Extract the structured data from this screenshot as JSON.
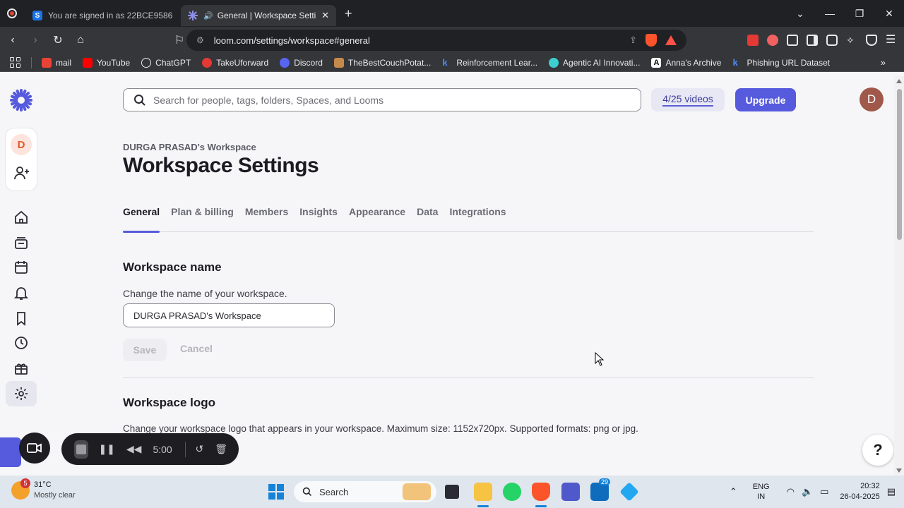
{
  "browser": {
    "tabs": [
      {
        "title": "You are signed in as 22BCE9586",
        "active": false,
        "favicon_color": "#1a73e8"
      },
      {
        "title": "General | Workspace Settings",
        "active": true,
        "favicon_color": "#565add"
      }
    ],
    "address": "loom.com/settings/workspace#general",
    "shields_count": "1",
    "bookmarks": [
      {
        "label": "mail",
        "color": "#ea4335"
      },
      {
        "label": "YouTube",
        "color": "#ff0000"
      },
      {
        "label": "ChatGPT",
        "color": "#e8eaed"
      },
      {
        "label": "TakeUforward",
        "color": "#e53935"
      },
      {
        "label": "Discord",
        "color": "#5865f2"
      },
      {
        "label": "TheBestCouchPotat...",
        "color": "#c58a4a"
      },
      {
        "label": "Reinforcement Lear...",
        "color": "#1a73e8"
      },
      {
        "label": "Agentic AI Innovati...",
        "color": "#3ccfcf"
      },
      {
        "label": "Anna's Archive",
        "color": "#ffffff"
      },
      {
        "label": "Phishing URL Dataset",
        "color": "#1a73e8"
      }
    ]
  },
  "loom": {
    "search_placeholder": "Search for people, tags, folders, Spaces, and Looms",
    "video_count": "4/25 videos",
    "upgrade_label": "Upgrade",
    "user_initial": "D",
    "workspace_initial": "D",
    "workspace_label": "DURGA PRASAD's Workspace",
    "page_title": "Workspace Settings",
    "tabs": [
      "General",
      "Plan & billing",
      "Members",
      "Insights",
      "Appearance",
      "Data",
      "Integrations"
    ],
    "active_tab": "General",
    "name_section": {
      "title": "Workspace name",
      "description": "Change the name of your workspace.",
      "value": "DURGA PRASAD's Workspace",
      "save_label": "Save",
      "cancel_label": "Cancel"
    },
    "logo_section": {
      "title": "Workspace logo",
      "description": "Change your workspace logo that appears in your workspace. Maximum size: 1152x720px. Supported formats: png or jpg."
    },
    "help_label": "?",
    "accent_color": "#565add"
  },
  "recorder": {
    "timer": "5:00"
  },
  "taskbar": {
    "weather_badge": "5",
    "temperature": "31°C",
    "condition": "Mostly clear",
    "search_label": "Search",
    "teams_badge": "29",
    "language": [
      "ENG",
      "IN"
    ],
    "time": "20:32",
    "date": "26-04-2025"
  }
}
